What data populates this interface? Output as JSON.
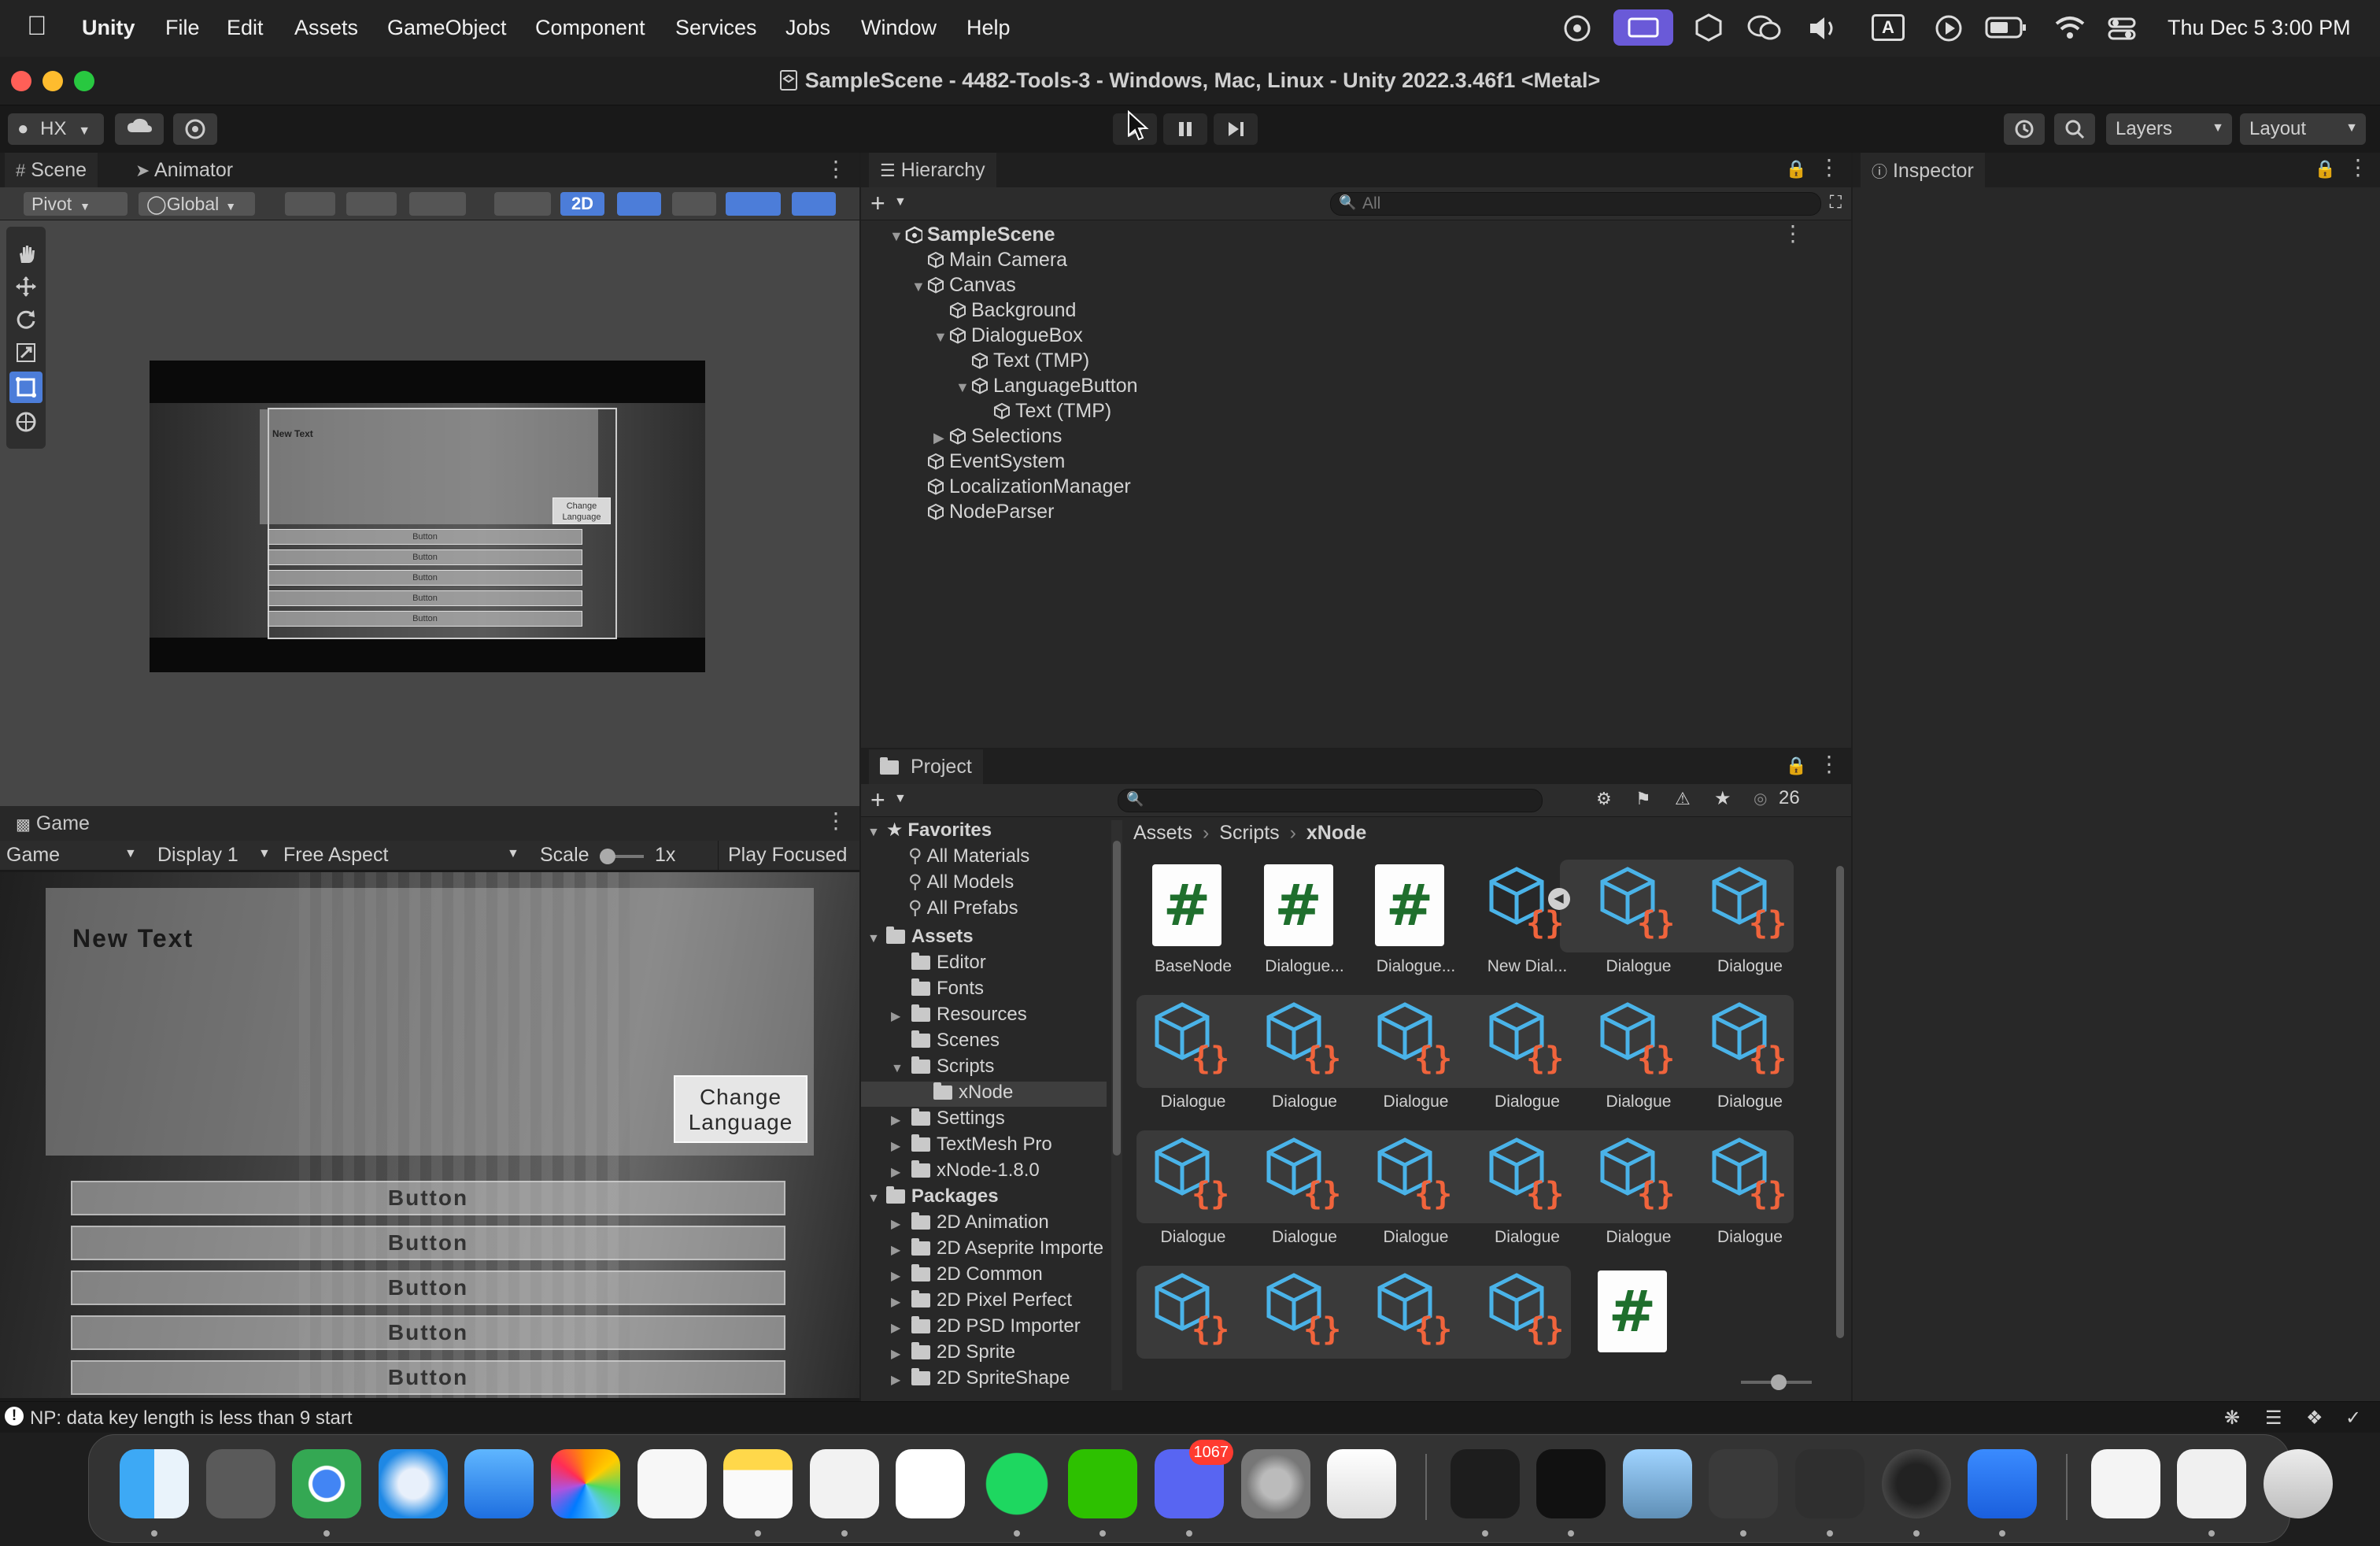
{
  "menubar": {
    "app": "Unity",
    "items": [
      "File",
      "Edit",
      "Assets",
      "GameObject",
      "Component",
      "Services",
      "Jobs",
      "Window",
      "Help"
    ],
    "clock": "Thu Dec 5  3:00 PM",
    "input_source": "A"
  },
  "window": {
    "title": "SampleScene - 4482-Tools-3 - Windows, Mac, Linux - Unity 2022.3.46f1 <Metal>"
  },
  "toolbar": {
    "account": "HX",
    "layers_label": "Layers",
    "layout_label": "Layout"
  },
  "scene_panel": {
    "tabs": [
      "Scene",
      "Animator"
    ],
    "pivot_label": "Pivot",
    "global_label": "Global",
    "toggle_2d": "2D",
    "preview": {
      "text": "New Text",
      "change_button": "Change Language",
      "buttons": [
        "Button",
        "Button",
        "Button",
        "Button",
        "Button"
      ]
    }
  },
  "game_panel": {
    "tab": "Game",
    "mode": "Game",
    "display": "Display 1",
    "aspect": "Free Aspect",
    "scale_label": "Scale",
    "scale_value": "1x",
    "play_focused": "Play Focused",
    "view": {
      "text": "New Text",
      "change_button_line1": "Change",
      "change_button_line2": "Language",
      "buttons": [
        "Button",
        "Button",
        "Button",
        "Button",
        "Button"
      ]
    }
  },
  "hierarchy": {
    "tab": "Hierarchy",
    "search_placeholder": "All",
    "rows": [
      {
        "label": "SampleScene",
        "depth": 0,
        "expanded": true,
        "bold": true
      },
      {
        "label": "Main Camera",
        "depth": 1
      },
      {
        "label": "Canvas",
        "depth": 1,
        "expanded": true
      },
      {
        "label": "Background",
        "depth": 2
      },
      {
        "label": "DialogueBox",
        "depth": 2,
        "expanded": true
      },
      {
        "label": "Text (TMP)",
        "depth": 3
      },
      {
        "label": "LanguageButton",
        "depth": 3,
        "expanded": true
      },
      {
        "label": "Text (TMP)",
        "depth": 4
      },
      {
        "label": "Selections",
        "depth": 2,
        "expanded": false
      },
      {
        "label": "EventSystem",
        "depth": 1
      },
      {
        "label": "LocalizationManager",
        "depth": 1
      },
      {
        "label": "NodeParser",
        "depth": 1
      }
    ]
  },
  "inspector": {
    "tab": "Inspector"
  },
  "project": {
    "tab": "Project",
    "hidden_count": "26",
    "breadcrumb": [
      "Assets",
      "Scripts",
      "xNode"
    ],
    "tree": [
      {
        "label": "Favorites",
        "kind": "fav-header"
      },
      {
        "label": "All Materials",
        "kind": "search"
      },
      {
        "label": "All Models",
        "kind": "search"
      },
      {
        "label": "All Prefabs",
        "kind": "search"
      },
      {
        "label": "Assets",
        "kind": "header"
      },
      {
        "label": "Editor",
        "kind": "folder",
        "depth": 1
      },
      {
        "label": "Fonts",
        "kind": "folder",
        "depth": 1
      },
      {
        "label": "Resources",
        "kind": "folder",
        "depth": 1,
        "arrow": true
      },
      {
        "label": "Scenes",
        "kind": "folder",
        "depth": 1
      },
      {
        "label": "Scripts",
        "kind": "folder",
        "depth": 1,
        "open": true
      },
      {
        "label": "xNode",
        "kind": "folder",
        "depth": 2,
        "selected": true
      },
      {
        "label": "Settings",
        "kind": "folder",
        "depth": 1,
        "arrow": true
      },
      {
        "label": "TextMesh Pro",
        "kind": "folder",
        "depth": 1,
        "arrow": true
      },
      {
        "label": "xNode-1.8.0",
        "kind": "folder",
        "depth": 1,
        "arrow": true
      },
      {
        "label": "Packages",
        "kind": "header"
      },
      {
        "label": "2D Animation",
        "kind": "folder",
        "depth": 1,
        "arrow": true
      },
      {
        "label": "2D Aseprite Importe",
        "kind": "folder",
        "depth": 1,
        "arrow": true
      },
      {
        "label": "2D Common",
        "kind": "folder",
        "depth": 1,
        "arrow": true
      },
      {
        "label": "2D Pixel Perfect",
        "kind": "folder",
        "depth": 1,
        "arrow": true
      },
      {
        "label": "2D PSD Importer",
        "kind": "folder",
        "depth": 1,
        "arrow": true
      },
      {
        "label": "2D Sprite",
        "kind": "folder",
        "depth": 1,
        "arrow": true
      },
      {
        "label": "2D SpriteShape",
        "kind": "folder",
        "depth": 1,
        "arrow": true
      }
    ],
    "assets": [
      {
        "label": "BaseNode",
        "kind": "script"
      },
      {
        "label": "Dialogue...",
        "kind": "script"
      },
      {
        "label": "Dialogue...",
        "kind": "script"
      },
      {
        "label": "New Dial...",
        "kind": "node"
      },
      {
        "label": "Dialogue",
        "kind": "node"
      },
      {
        "label": "Dialogue",
        "kind": "node"
      },
      {
        "label": "Dialogue",
        "kind": "node"
      },
      {
        "label": "Dialogue",
        "kind": "node"
      },
      {
        "label": "Dialogue",
        "kind": "node"
      },
      {
        "label": "Dialogue",
        "kind": "node"
      },
      {
        "label": "Dialogue",
        "kind": "node"
      },
      {
        "label": "Dialogue",
        "kind": "node"
      },
      {
        "label": "Dialogue",
        "kind": "node"
      },
      {
        "label": "Dialogue",
        "kind": "node"
      },
      {
        "label": "Dialogue",
        "kind": "node"
      },
      {
        "label": "Dialogue",
        "kind": "node"
      },
      {
        "label": "Dialogue",
        "kind": "node"
      },
      {
        "label": "Dialogue",
        "kind": "node"
      },
      {
        "label": "",
        "kind": "node"
      },
      {
        "label": "",
        "kind": "node"
      },
      {
        "label": "",
        "kind": "node"
      },
      {
        "label": "",
        "kind": "node"
      },
      {
        "label": "",
        "kind": "script"
      }
    ]
  },
  "statusbar": {
    "message": "NP: data key length is less than 9 start"
  },
  "dock": {
    "discord_badge": "1067",
    "apps": [
      "finder-icon",
      "launchpad-icon",
      "chrome-icon",
      "safari-icon",
      "mail-icon",
      "photos-icon",
      "reminders-icon",
      "notes-icon",
      "vscode-icon",
      "notion-icon",
      "spotify-icon",
      "wechat-icon",
      "discord-icon",
      "system-settings-icon",
      "iphone-mirroring-icon",
      "activity-monitor-icon",
      "terminal-icon",
      "preview-icon",
      "unity-hub-icon",
      "unity-icon",
      "obs-icon",
      "zoom-icon",
      "document-icon",
      "browser-window-icon",
      "trash-icon"
    ]
  },
  "colors": {
    "accent_blue": "#4c7dd9",
    "node_icon_blue": "#4ab3e8",
    "node_icon_orange": "#f0643c",
    "script_green": "#1f6f2d"
  }
}
